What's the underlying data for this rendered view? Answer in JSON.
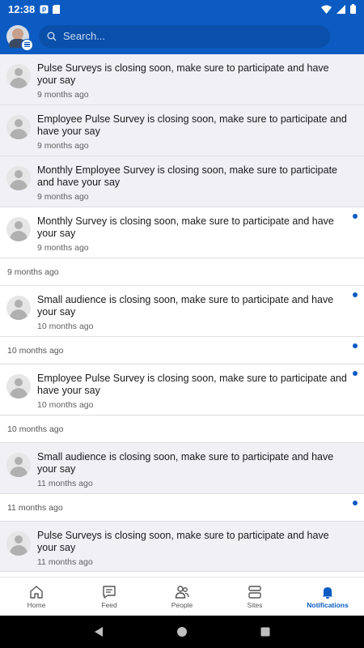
{
  "status_bar": {
    "time": "12:38"
  },
  "header": {
    "search_placeholder": "Search..."
  },
  "rows": [
    {
      "kind": "notif",
      "bg": "grey",
      "message": "Pulse Surveys is closing soon, make sure to participate and have your say",
      "ago": "9 months ago",
      "unread": false
    },
    {
      "kind": "notif",
      "bg": "grey",
      "message": "Employee Pulse Survey is closing soon, make sure to participate and have your say",
      "ago": "9 months ago",
      "unread": false
    },
    {
      "kind": "notif",
      "bg": "grey",
      "message": "Monthly Employee Survey is closing soon, make sure to participate and have your say",
      "ago": "9 months ago",
      "unread": false
    },
    {
      "kind": "notif",
      "bg": "white",
      "message": "Monthly Survey is closing soon, make sure to participate and have your say",
      "ago": "9 months ago",
      "unread": true
    },
    {
      "kind": "sep",
      "text": "9 months ago",
      "unread": false
    },
    {
      "kind": "notif",
      "bg": "white",
      "message": "Small audience is closing soon, make sure to participate and have your say",
      "ago": "10 months ago",
      "unread": true
    },
    {
      "kind": "sep",
      "text": "10 months ago",
      "unread": true
    },
    {
      "kind": "notif",
      "bg": "white",
      "message": "Employee Pulse Survey is closing soon, make sure to participate and have your say",
      "ago": "10 months ago",
      "unread": true
    },
    {
      "kind": "sep",
      "text": "10 months ago",
      "unread": false
    },
    {
      "kind": "notif",
      "bg": "grey",
      "message": "Small audience is closing soon, make sure to participate and have your say",
      "ago": "11 months ago",
      "unread": false
    },
    {
      "kind": "sep",
      "text": "11 months ago",
      "unread": true
    },
    {
      "kind": "notif",
      "bg": "grey",
      "message": "Pulse Surveys is closing soon, make sure to participate and have your say",
      "ago": "11 months ago",
      "unread": false
    }
  ],
  "bottom_nav": [
    {
      "id": "home",
      "label": "Home",
      "icon": "home-icon",
      "active": false
    },
    {
      "id": "feed",
      "label": "Feed",
      "icon": "feed-icon",
      "active": false
    },
    {
      "id": "people",
      "label": "People",
      "icon": "people-icon",
      "active": false
    },
    {
      "id": "sites",
      "label": "Sites",
      "icon": "sites-icon",
      "active": false
    },
    {
      "id": "notifications",
      "label": "Notifications",
      "icon": "bell-icon",
      "active": true
    }
  ],
  "colors": {
    "accent": "#0b5bc2",
    "unread_bg": "#f0f0f5"
  }
}
